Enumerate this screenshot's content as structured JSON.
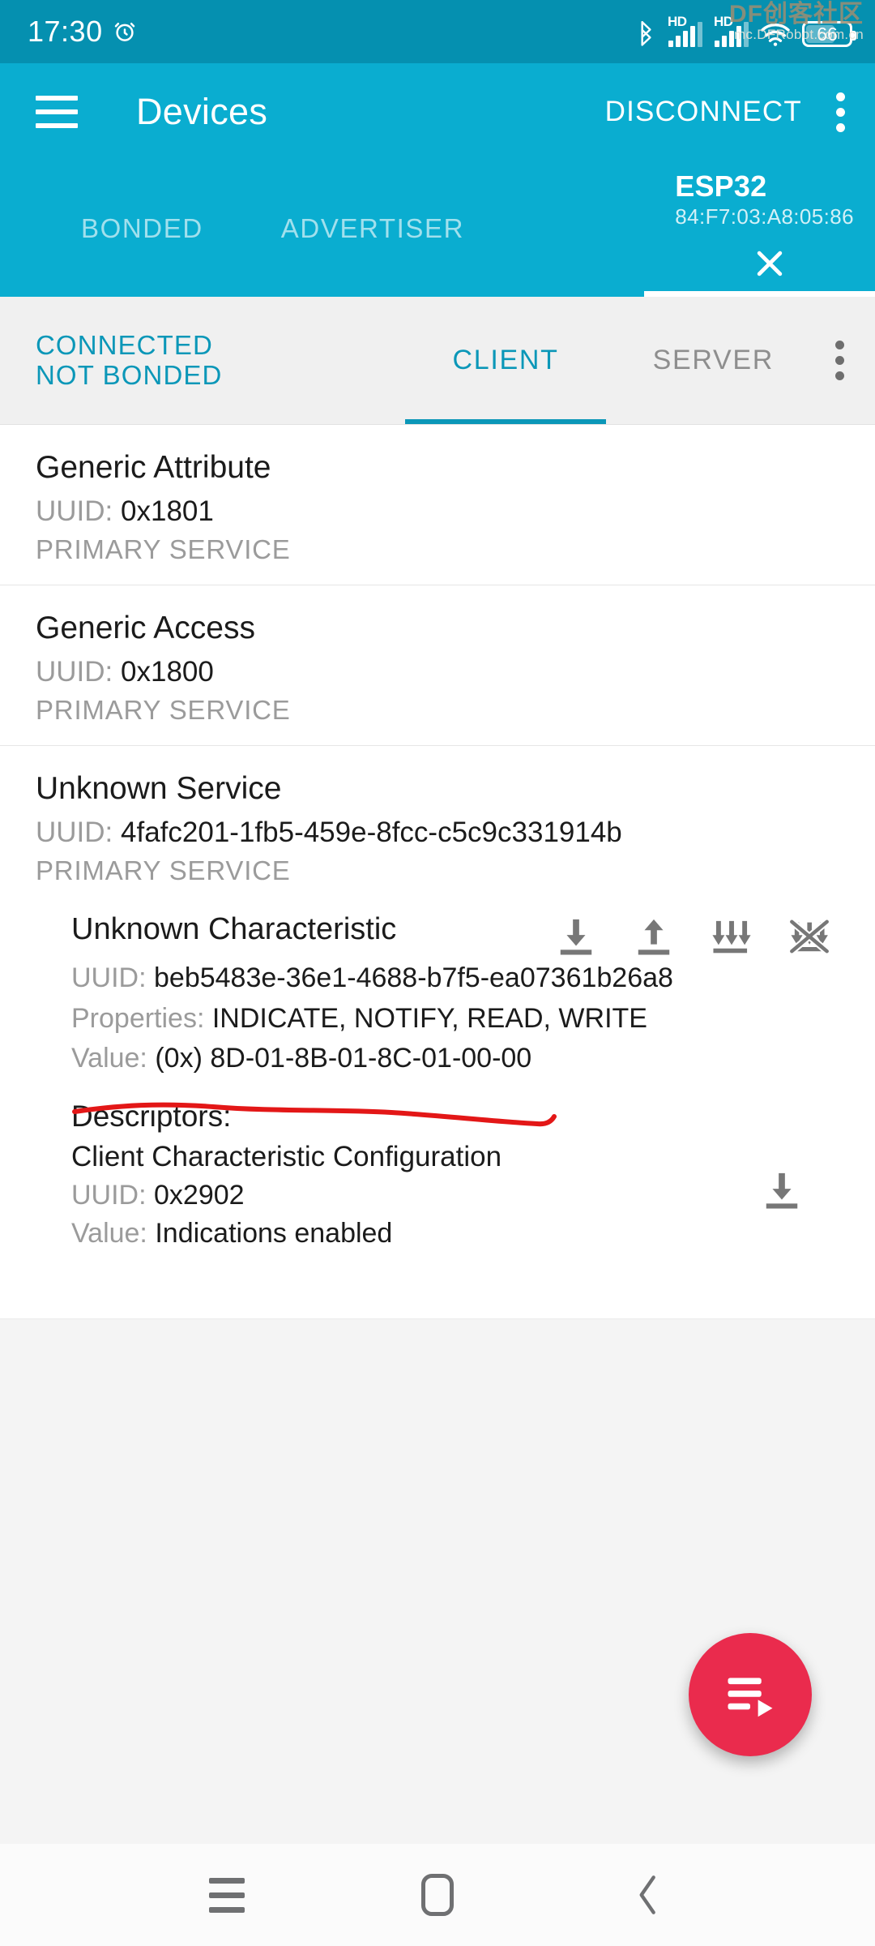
{
  "status_bar": {
    "time": "17:30",
    "alarm_icon": "alarm-clock-icon",
    "bluetooth_icon": "bluetooth-icon",
    "signal_1_label": "HD",
    "signal_2_label": "HD",
    "wifi_icon": "wifi-icon",
    "battery_level": "66",
    "bg_color": "#0590b0"
  },
  "watermark": {
    "line1": "DF创客社区",
    "line2": "mc.DFRobot.com.cn"
  },
  "app_bar": {
    "menu_icon": "hamburger-menu-icon",
    "title": "Devices",
    "disconnect_label": "DISCONNECT",
    "overflow_icon": "kebab-menu-icon",
    "bg_color": "#0aadd0"
  },
  "device_tabs": [
    {
      "label": "BONDED",
      "active": false
    },
    {
      "label": "ADVERTISER",
      "active": false
    }
  ],
  "active_device_tab": {
    "name": "ESP32",
    "address": "84:F7:03:A8:05:86",
    "close_icon": "close-icon",
    "active": true
  },
  "connection": {
    "state": "CONNECTED",
    "bond_state": "NOT BONDED",
    "accent_color": "#0b97b8",
    "tabs": [
      {
        "label": "CLIENT",
        "active": true
      },
      {
        "label": "SERVER",
        "active": false
      }
    ],
    "overflow_icon": "kebab-menu-icon"
  },
  "labels": {
    "uuid": "UUID:",
    "properties": "Properties:",
    "value": "Value:",
    "descriptors": "Descriptors:",
    "primary_service": "PRIMARY SERVICE"
  },
  "services": [
    {
      "name": "Generic Attribute",
      "uuid": "0x1801",
      "type": "PRIMARY SERVICE"
    },
    {
      "name": "Generic Access",
      "uuid": "0x1800",
      "type": "PRIMARY SERVICE"
    },
    {
      "name": "Unknown Service",
      "uuid": "4fafc201-1fb5-459e-8fcc-c5c9c331914b",
      "type": "PRIMARY SERVICE"
    }
  ],
  "characteristic": {
    "name": "Unknown Characteristic",
    "uuid": "beb5483e-36e1-4688-b7f5-ea07361b26a8",
    "properties": "INDICATE, NOTIFY, READ, WRITE",
    "value_prefix": "(0x)",
    "value": "8D-01-8B-01-8C-01-00-00",
    "actions": [
      "read-icon",
      "write-icon",
      "subscribe-notify-icon",
      "unsubscribe-notify-icon"
    ],
    "annotation_color": "#e31717"
  },
  "descriptor": {
    "name": "Client Characteristic Configuration",
    "uuid": "0x2902",
    "value": "Indications enabled",
    "read_icon": "read-icon"
  },
  "fab": {
    "icon": "playlist-play-icon",
    "color": "#ea2b4d"
  },
  "nav_bar": {
    "recents_icon": "recents-icon",
    "home_icon": "home-icon",
    "back_icon": "back-chevron-icon"
  }
}
